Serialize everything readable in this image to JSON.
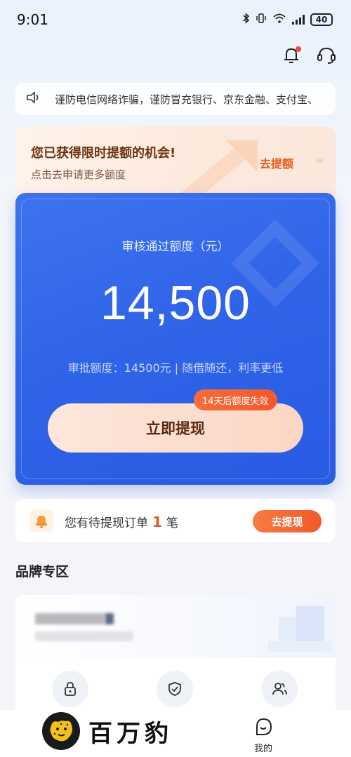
{
  "status_bar": {
    "time": "9:01",
    "battery": "40"
  },
  "header": {
    "icons": [
      "bell-icon",
      "customer-service-icon"
    ]
  },
  "notice": {
    "icon": "speaker-icon",
    "text": "谨防电信网络诈骗，谨防冒充银行、京东金融、支付宝、"
  },
  "promo": {
    "title": "您已获得限时提额的机会!",
    "subtitle": "点击去申请更多额度",
    "link": "去提额"
  },
  "credit_card": {
    "label": "审核通过额度（元）",
    "amount": "14,500",
    "description": "审批额度：14500元 | 随借随还，利率更低",
    "button": "立即提现",
    "badge": "14天后额度失效"
  },
  "pending": {
    "text_before": "您有待提现订单",
    "count": "1",
    "text_after": "笔",
    "button": "去提现"
  },
  "brand": {
    "title": "品牌专区"
  },
  "features": {
    "icons": [
      "lock-icon",
      "shield-check-icon",
      "users-icon"
    ]
  },
  "bottom": {
    "watermark": "百万豹",
    "tab_mine": "我的"
  },
  "colors": {
    "primary_blue": "#2f63e8",
    "accent_orange": "#f05a28",
    "promo_brown": "#6b3311"
  }
}
